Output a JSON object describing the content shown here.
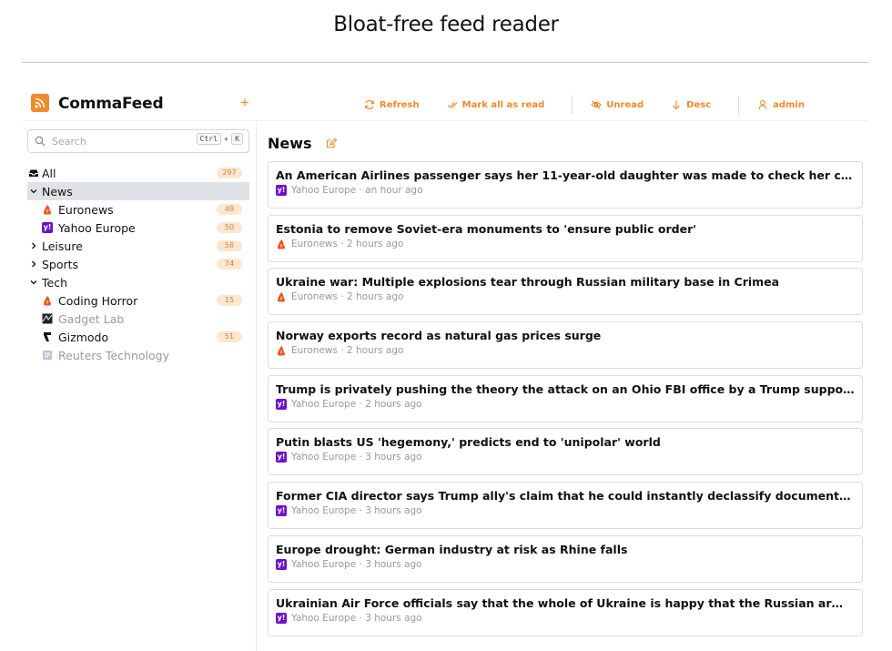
{
  "page": {
    "heading": "Bloat-free feed reader"
  },
  "header": {
    "brand": "CommaFeed",
    "add_label": "+",
    "toolbar": [
      {
        "name": "refresh",
        "label": "Refresh",
        "icon": "refresh-icon"
      },
      {
        "name": "mark-all-as-read",
        "label": "Mark all as read",
        "icon": "checks-icon"
      },
      {
        "name": "unread",
        "label": "Unread",
        "icon": "eye-off-icon"
      },
      {
        "name": "desc",
        "label": "Desc",
        "icon": "arrow-down-icon"
      },
      {
        "name": "admin",
        "label": "admin",
        "icon": "user-icon"
      }
    ],
    "accent_color": "#f08b2a"
  },
  "sidebar": {
    "search": {
      "placeholder": "Search",
      "shortcut_key1": "Ctrl",
      "shortcut_plus": "+",
      "shortcut_key2": "K"
    },
    "tree": [
      {
        "label": "All",
        "count": "297",
        "type": "all"
      },
      {
        "label": "News",
        "count": "",
        "type": "category-open",
        "selected": true
      },
      {
        "label": "Euronews",
        "count": "49",
        "type": "feed",
        "icon": "euronews-icon"
      },
      {
        "label": "Yahoo Europe",
        "count": "50",
        "type": "feed",
        "icon": "yahoo-icon"
      },
      {
        "label": "Leisure",
        "count": "58",
        "type": "category-closed"
      },
      {
        "label": "Sports",
        "count": "74",
        "type": "category-closed"
      },
      {
        "label": "Tech",
        "count": "",
        "type": "category-open"
      },
      {
        "label": "Coding Horror",
        "count": "15",
        "type": "feed",
        "icon": "coding-horror-icon"
      },
      {
        "label": "Gadget Lab",
        "count": "",
        "type": "feed",
        "icon": "gadget-lab-icon",
        "dim": true
      },
      {
        "label": "Gizmodo",
        "count": "51",
        "type": "feed",
        "icon": "gizmodo-icon"
      },
      {
        "label": "Reuters Technology",
        "count": "",
        "type": "feed",
        "icon": "reuters-icon",
        "dim": true
      }
    ]
  },
  "content": {
    "title": "News",
    "entries": [
      {
        "title": "An American Airlines passenger says her 11-year-old daughter was made to check her carry-on on a flight t...",
        "source": "Yahoo Europe",
        "time": "an hour ago",
        "icon": "yahoo-icon"
      },
      {
        "title": "Estonia to remove Soviet-era monuments to 'ensure public order'",
        "source": "Euronews",
        "time": "2 hours ago",
        "icon": "euronews-icon"
      },
      {
        "title": "Ukraine war: Multiple explosions tear through Russian military base in Crimea",
        "source": "Euronews",
        "time": "2 hours ago",
        "icon": "euronews-icon"
      },
      {
        "title": "Norway exports record as natural gas prices surge",
        "source": "Euronews",
        "time": "2 hours ago",
        "icon": "euronews-icon"
      },
      {
        "title": "Trump is privately pushing the theory the attack on an Ohio FBI office by a Trump supporter was a false fla...",
        "source": "Yahoo Europe",
        "time": "2 hours ago",
        "icon": "yahoo-icon"
      },
      {
        "title": "Putin blasts US 'hegemony,' predicts end to 'unipolar' world",
        "source": "Yahoo Europe",
        "time": "3 hours ago",
        "icon": "yahoo-icon"
      },
      {
        "title": "Former CIA director says Trump ally's claim that he could instantly declassify documents is 'pretty much BS'",
        "source": "Yahoo Europe",
        "time": "3 hours ago",
        "icon": "yahoo-icon"
      },
      {
        "title": "Europe drought: German industry at risk as Rhine falls",
        "source": "Yahoo Europe",
        "time": "3 hours ago",
        "icon": "yahoo-icon"
      },
      {
        "title": "Ukrainian Air Force officials say that the whole of Ukraine is happy that the Russian army doesnt observe fi...",
        "source": "Yahoo Europe",
        "time": "3 hours ago",
        "icon": "yahoo-icon"
      }
    ],
    "meta_separator": " · "
  }
}
